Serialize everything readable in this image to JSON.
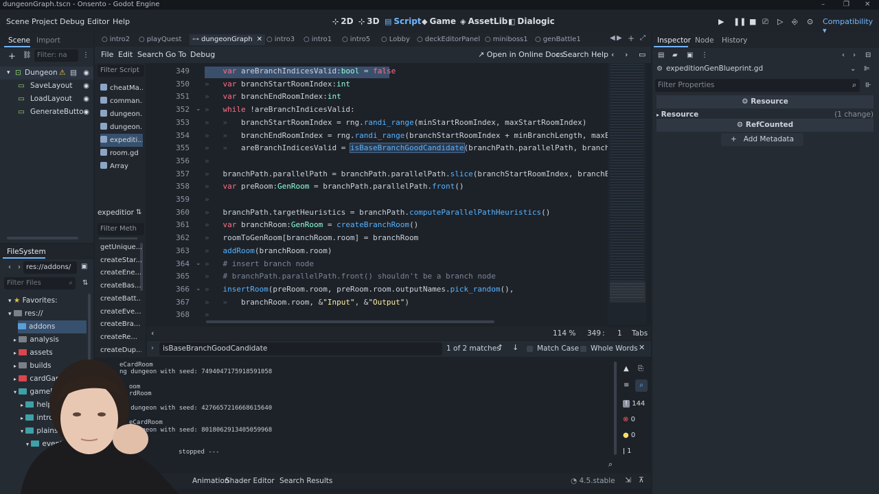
{
  "window": {
    "title": "dungeonGraph.tscn - Onsento - Godot Engine",
    "controls": [
      "–",
      "❐",
      "✕"
    ]
  },
  "menus": [
    "Scene",
    "Project",
    "Debug",
    "Editor",
    "Help"
  ],
  "workspaces": [
    {
      "label": "2D",
      "icon": "2d-icon"
    },
    {
      "label": "3D",
      "icon": "3d-icon"
    },
    {
      "label": "Script",
      "icon": "script-icon",
      "active": true
    },
    {
      "label": "Game",
      "icon": "game-icon"
    },
    {
      "label": "AssetLib",
      "icon": "assetlib-icon"
    },
    {
      "label": "Dialogic",
      "icon": "dialogic-icon"
    }
  ],
  "renderer": "Compatibility",
  "scene_dock": {
    "tabs": [
      "Scene",
      "Import"
    ],
    "filter_placeholder": "Filter: na",
    "tree": [
      {
        "label": "Dungeon",
        "root": true,
        "warning": true
      },
      {
        "label": "SaveLayout"
      },
      {
        "label": "LoadLayout"
      },
      {
        "label": "GenerateButto"
      }
    ]
  },
  "filesystem": {
    "tab": "FileSystem",
    "path": "res://addons/",
    "filter_placeholder": "Filter Files",
    "items": [
      {
        "label": "Favorites:",
        "type": "favorites"
      },
      {
        "label": "res://",
        "type": "root"
      },
      {
        "label": "addons",
        "color": "#5a9fd6",
        "selected": true
      },
      {
        "label": "analysis",
        "color": "#7a7f88"
      },
      {
        "label": "assets",
        "color": "#d8474e"
      },
      {
        "label": "builds",
        "color": "#7a7f88"
      },
      {
        "label": "cardGameplа",
        "color": "#d8474e"
      },
      {
        "label": "gameDunge",
        "color": "#3fa0a8"
      },
      {
        "label": "helpers",
        "color": "#3fa0a8"
      },
      {
        "label": "intro",
        "color": "#3fa0a8"
      },
      {
        "label": "plains",
        "color": "#3fa0a8"
      },
      {
        "label": "events",
        "color": "#3fa0a8"
      }
    ]
  },
  "script_tabs": [
    "intro2",
    "playQuest",
    "dungeonGraph",
    "intro3",
    "intro1",
    "intro5",
    "Lobby",
    "deckEditorPanel",
    "miniboss1",
    "genBattle1"
  ],
  "script_menu": [
    "File",
    "Edit",
    "Search",
    "Go To",
    "Debug"
  ],
  "script_toolbar": {
    "online_docs": "Open in Online Docs",
    "search_help": "Search Help"
  },
  "script_list": {
    "filter_placeholder": "Filter Script",
    "items": [
      "cheatMa...",
      "comman...",
      "dungeon...",
      "dungeon...",
      "expediti...",
      "room.gd",
      "Array"
    ],
    "selected_index": 4,
    "methods_header": "expeditior",
    "methods_filter_placeholder": "Filter Meth",
    "methods": [
      "getUnique...",
      "createStar...",
      "createEne...",
      "createBas...",
      "createBatt...",
      "createEve...",
      "createBra...",
      "createRe...",
      "createDup..."
    ]
  },
  "code": {
    "lines": [
      {
        "n": "349",
        "html": "<span class='tabch'>»</span>   <span class='kw'>var</span> areBranchIndicesValid:<span class='ty'>bool</span> = <span class='kw'>false</span>"
      },
      {
        "n": "350",
        "html": "<span class='tabch'>»</span>   <span class='kw'>var</span> branchStartRoomIndex:<span class='ty'>int</span>"
      },
      {
        "n": "351",
        "html": "<span class='tabch'>»</span>   <span class='kw'>var</span> branchEndRoomIndex:<span class='ty'>int</span>"
      },
      {
        "n": "352",
        "html": "<span class='tabch'>»</span>   <span class='kw'>while</span> !areBranchIndicesValid:"
      },
      {
        "n": "353",
        "html": "<span class='tabch'>»</span>   <span class='tabch'>»</span>   branchStartRoomIndex = rng.<span class='fn'>randi_range</span>(minStartRoomIndex, maxStartRoomIndex)"
      },
      {
        "n": "354",
        "html": "<span class='tabch'>»</span>   <span class='tabch'>»</span>   branchEndRoomIndex = rng.<span class='fn'>randi_range</span>(branchStartRoomIndex + minBranchLength, maxEndR"
      },
      {
        "n": "355",
        "html": "<span class='tabch'>»</span>   <span class='tabch'>»</span>   areBranchIndicesValid = <span class='fn' style='background:#2b3a4f;outline:1px solid #4b6a92'>isBaseBranchGoodCandidate</span>(branchPath.parallelPath, branchSta"
      },
      {
        "n": "356",
        "html": "<span class='tabch'>»</span>"
      },
      {
        "n": "357",
        "html": "<span class='tabch'>»</span>   branchPath.parallelPath = branchPath.parallelPath.<span class='fn'>slice</span>(branchStartRoomIndex, branchEndR"
      },
      {
        "n": "358",
        "html": "<span class='tabch'>»</span>   <span class='kw'>var</span> preRoom:<span class='ty'>GenRoom</span> = branchPath.parallelPath.<span class='fn'>front</span>()"
      },
      {
        "n": "359",
        "html": "<span class='tabch'>»</span>"
      },
      {
        "n": "360",
        "html": "<span class='tabch'>»</span>   branchPath.targetHeuristics = branchPath.<span class='fn'>computeParallelPathHeuristics</span>()"
      },
      {
        "n": "361",
        "html": "<span class='tabch'>»</span>   <span class='kw'>var</span> branchRoom:<span class='ty'>GenRoom</span> = <span class='fn'>createBranchRoom</span>()"
      },
      {
        "n": "362",
        "html": "<span class='tabch'>»</span>   roomToGenRoom[branchRoom.room] = branchRoom"
      },
      {
        "n": "363",
        "html": "<span class='tabch'>»</span>   <span class='fn'>addRoom</span>(branchRoom.room)"
      },
      {
        "n": "364",
        "html": "<span class='tabch'>»</span>   <span class='cm'># insert branch node</span>"
      },
      {
        "n": "365",
        "html": "<span class='tabch'>»</span>   <span class='cm'># branchPath.parallelPath.front() shouldn't be a branch node</span>"
      },
      {
        "n": "366",
        "html": "<span class='tabch'>»</span>   <span class='fn'>insertRoom</span>(preRoom.room, preRoom.room.outputNames.<span class='fn'>pick_random</span>(),"
      },
      {
        "n": "367",
        "html": "<span class='tabch'>»</span>   <span class='tabch'>»</span>   branchRoom.room, &amp;<span class='st'>\"Input\"</span>, &amp;<span class='st'>\"Output\"</span>)"
      },
      {
        "n": "368",
        "html": "<span class='tabch'>»</span>"
      }
    ],
    "fold_lines": [
      "352",
      "364",
      "366"
    ]
  },
  "status": {
    "zoom": "114 %",
    "line": "349",
    "sep": ":",
    "col": "1",
    "indent": "Tabs"
  },
  "find": {
    "query": "isBaseBranchGoodCandidate",
    "matches": "1 of 2 matches",
    "match_case": "Match Case",
    "whole_words": "Whole Words"
  },
  "output": {
    "lines": [
      "eCardRoom",
      "ng dungeon with seed: 7494047175918591058",
      "oom",
      "rdRoom",
      "ng dungeon with seed: 4276657216668615640",
      "eCardRoom",
      "ng dungeon with seed: 8018062913405059968",
      "om",
      "stopped ---"
    ],
    "counts": {
      "log": "144",
      "errors": "0",
      "warnings": "0",
      "info": "1"
    }
  },
  "bottom_tabs": [
    "Animation",
    "Shader Editor",
    "Search Results"
  ],
  "version": "4.5.stable",
  "inspector": {
    "tabs": [
      "Inspector",
      "Node",
      "History"
    ],
    "resource_file": "expeditionGenBlueprint.gd",
    "filter_placeholder": "Filter Properties",
    "section_resource": "Resource",
    "group_resource": "Resource",
    "change_note": "(1 change)",
    "section_refcounted": "RefCounted",
    "add_metadata": "Add Metadata"
  },
  "colors": {
    "accent": "#71b7ff",
    "keyword": "#ff7085",
    "type": "#8effda",
    "function": "#57b3ff",
    "comment": "#7c8595",
    "string": "#ffeda1"
  }
}
